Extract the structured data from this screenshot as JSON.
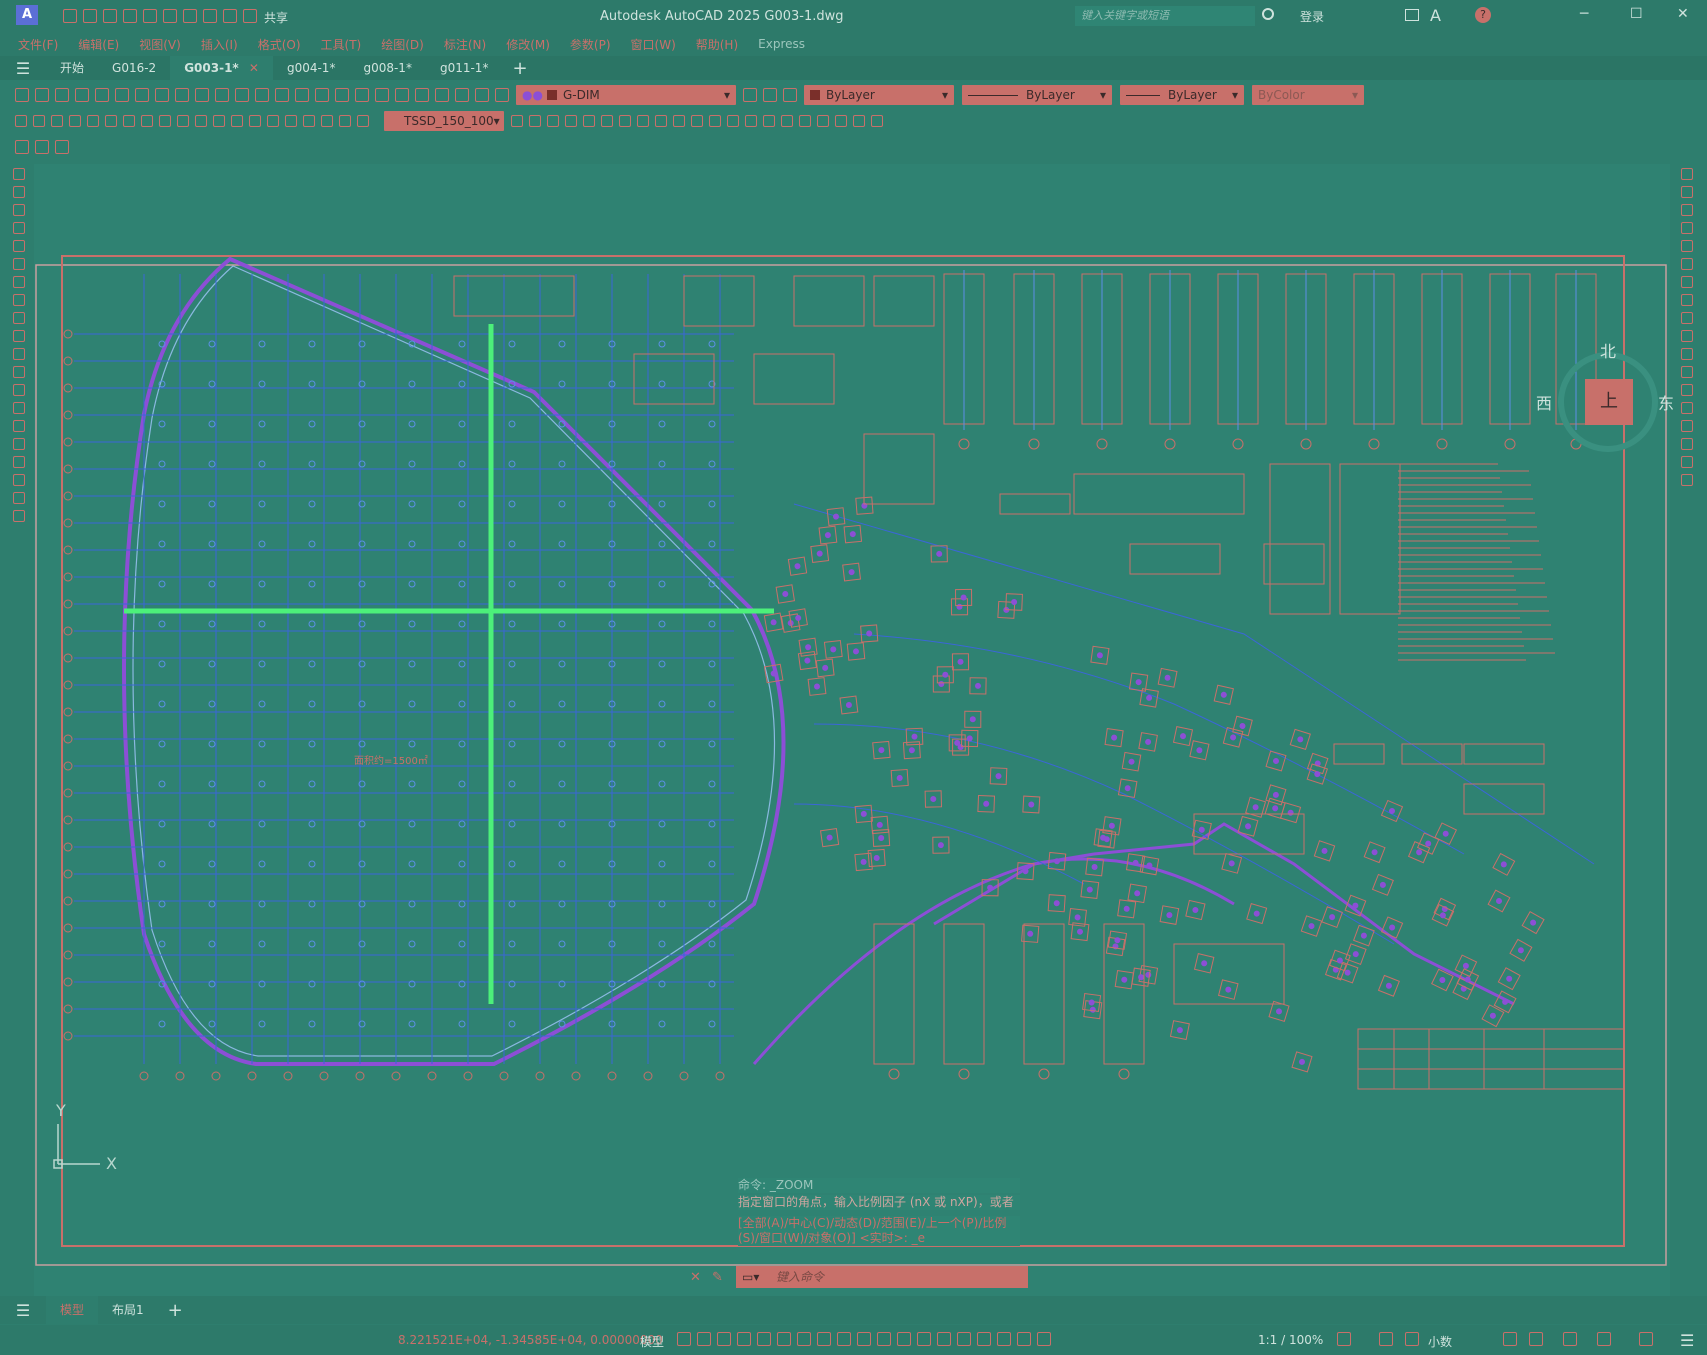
{
  "app": {
    "title": "Autodesk AutoCAD 2025    G003-1.dwg",
    "share_label": "共享",
    "search_placeholder": "键入关键字或短语",
    "login_label": "登录"
  },
  "menu": [
    "文件(F)",
    "编辑(E)",
    "视图(V)",
    "插入(I)",
    "格式(O)",
    "工具(T)",
    "绘图(D)",
    "标注(N)",
    "修改(M)",
    "参数(P)",
    "窗口(W)",
    "帮助(H)",
    "Express"
  ],
  "tabs": [
    {
      "label": "开始",
      "active": false
    },
    {
      "label": "G016-2",
      "active": false
    },
    {
      "label": "G003-1*",
      "active": true
    },
    {
      "label": "g004-1*",
      "active": false
    },
    {
      "label": "g008-1*",
      "active": false
    },
    {
      "label": "g011-1*",
      "active": false
    }
  ],
  "toolbar": {
    "layer": "G-DIM",
    "color": "ByLayer",
    "linetype": "ByLayer",
    "lineweight": "ByLayer",
    "plotstyle": "ByColor",
    "dimstyle": "TSSD_150_100"
  },
  "viewcube": {
    "north": "北",
    "west": "西",
    "east": "东",
    "top": "上"
  },
  "drawing": {
    "text_area": "面积约=1500㎡",
    "axis_y": "Y",
    "axis_x": "X"
  },
  "command": {
    "history": [
      "命令: _ZOOM",
      "指定窗口的角点，输入比例因子 (nX 或 nXP)，或者",
      "[全部(A)/中心(C)/动态(D)/范围(E)/上一个(P)/比例(S)/窗口(W)/对象(O)] <实时>: _e"
    ],
    "placeholder": "键入命令"
  },
  "layout_tabs": [
    {
      "label": "模型",
      "active": true
    },
    {
      "label": "布局1",
      "active": false
    }
  ],
  "status": {
    "coords": "8.221521E+04, -1.34585E+04, 0.00000000",
    "model_label": "模型",
    "scale": "1:1 / 100%",
    "units": "小数"
  },
  "colors": {
    "background": "#2f8272",
    "accent": "#c8706a",
    "wall": "#8c4fd6",
    "grid": "#3b66d8",
    "highlight": "#4cf07a"
  }
}
